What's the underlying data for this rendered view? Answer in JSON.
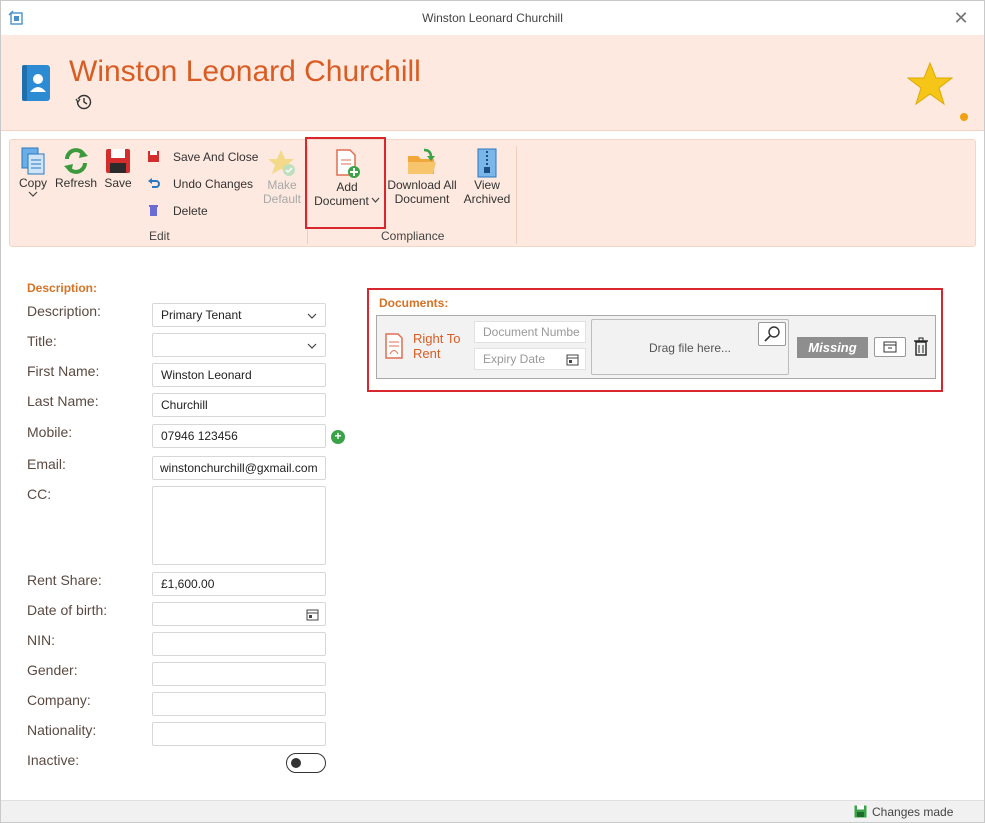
{
  "window": {
    "title": "Winston Leonard Churchill"
  },
  "header": {
    "name": "Winston Leonard Churchill"
  },
  "ribbon": {
    "copy": "Copy",
    "refresh": "Refresh",
    "save": "Save",
    "save_and_close": "Save And Close",
    "undo_changes": "Undo Changes",
    "delete": "Delete",
    "make_default_1": "Make",
    "make_default_2": "Default",
    "edit_group": "Edit",
    "add_document_1": "Add",
    "add_document_2": "Document",
    "download_all_1": "Download All",
    "download_all_2": "Document",
    "view_archived_1": "View",
    "view_archived_2": "Archived",
    "compliance_group": "Compliance"
  },
  "form": {
    "section_title": "Description:",
    "labels": {
      "description": "Description:",
      "title": "Title:",
      "first_name": "First Name:",
      "last_name": "Last Name:",
      "mobile": "Mobile:",
      "email": "Email:",
      "cc": "CC:",
      "rent_share": "Rent Share:",
      "dob": "Date of birth:",
      "nin": "NIN:",
      "gender": "Gender:",
      "company": "Company:",
      "nationality": "Nationality:",
      "inactive": "Inactive:"
    },
    "values": {
      "description": "Primary Tenant",
      "title": "",
      "first_name": "Winston Leonard",
      "last_name": "Churchill",
      "mobile": "07946 123456",
      "email": "winstonchurchill@gxmail.com",
      "cc": "",
      "rent_share": "£1,600.00",
      "dob": "",
      "nin": "",
      "gender": "",
      "company": "",
      "nationality": ""
    },
    "inactive": false
  },
  "documents": {
    "title": "Documents:",
    "rows": [
      {
        "type_line1": "Right To",
        "type_line2": "Rent",
        "doc_number_placeholder": "Document Numbe",
        "expiry_placeholder": "Expiry Date",
        "drop_text": "Drag file here...",
        "status": "Missing"
      }
    ]
  },
  "status": {
    "text": "Changes made"
  },
  "colors": {
    "accent": "#d85c23",
    "header_bg": "#fde9df",
    "highlight": "#d8262d"
  }
}
